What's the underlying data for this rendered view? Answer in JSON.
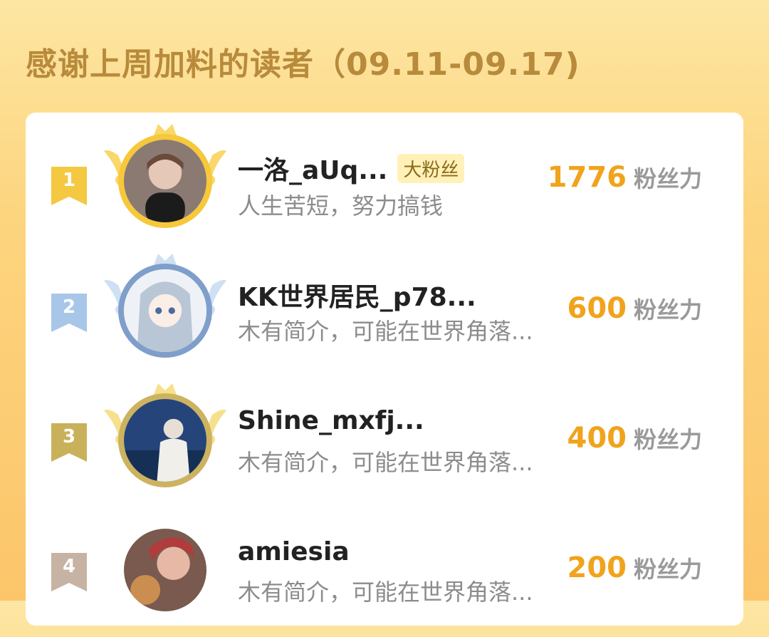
{
  "header": {
    "title": "感谢上周加料的读者（09.11-09.17)"
  },
  "colors": {
    "gold": "#f5c842",
    "silver": "#a8c6e8",
    "bronze": "#c9b15b",
    "plain": "#c7b3a3",
    "accent": "#f0a31b"
  },
  "readers": [
    {
      "rank": "1",
      "name": "一洛_aUq...",
      "badge": "大粉丝",
      "bio": "人生苦短，努力搞钱",
      "score": "1776",
      "unit": "粉丝力",
      "avatar_icon": "user-avatar-icon"
    },
    {
      "rank": "2",
      "name": "KK世界居民_p78...",
      "badge": "",
      "bio": "木有简介，可能在世界角落...",
      "score": "600",
      "unit": "粉丝力",
      "avatar_icon": "user-avatar-icon"
    },
    {
      "rank": "3",
      "name": "Shine_mxfj...",
      "badge": "",
      "bio": "木有简介，可能在世界角落...",
      "score": "400",
      "unit": "粉丝力",
      "avatar_icon": "user-avatar-icon"
    },
    {
      "rank": "4",
      "name": "amiesia",
      "badge": "",
      "bio": "木有简介，可能在世界角落...",
      "score": "200",
      "unit": "粉丝力",
      "avatar_icon": "user-avatar-icon"
    }
  ]
}
